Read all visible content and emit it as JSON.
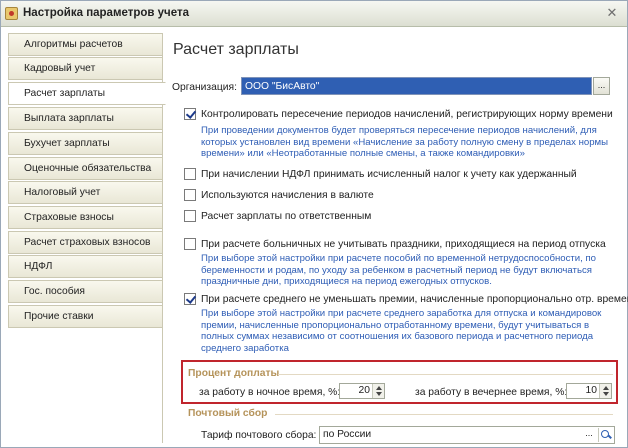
{
  "window": {
    "title": "Настройка параметров учета",
    "close_glyph": "✕"
  },
  "sidebar": {
    "items": [
      {
        "label": "Алгоритмы расчетов"
      },
      {
        "label": "Кадровый учет"
      },
      {
        "label": "Расчет зарплаты",
        "active": true
      },
      {
        "label": "Выплата зарплаты"
      },
      {
        "label": "Бухучет зарплаты"
      },
      {
        "label": "Оценочные обязательства"
      },
      {
        "label": "Налоговый учет"
      },
      {
        "label": "Страховые взносы"
      },
      {
        "label": "Расчет страховых взносов"
      },
      {
        "label": "НДФЛ"
      },
      {
        "label": "Гос. пособия"
      },
      {
        "label": "Прочие ставки"
      }
    ]
  },
  "main": {
    "title": "Расчет зарплаты",
    "organization": {
      "label": "Организация:",
      "value": "ООО \"БисАвто\"",
      "button": "..."
    },
    "options": [
      {
        "label": "Контролировать пересечение периодов начислений, регистрирующих норму времени",
        "checked": true,
        "hint": [
          "При проведении документов будет проверяться пересечение периодов начислений, для",
          "которых установлен вид времени «Начисление за работу полную смену в пределах нормы",
          "времени» или «Неотработанные полные смены, а также командировки»"
        ]
      },
      {
        "label": "При начислении НДФЛ принимать исчисленный налог к учету как удержанный",
        "checked": false
      },
      {
        "label": "Используются начисления в валюте",
        "checked": false
      },
      {
        "label": "Расчет зарплаты по ответственным",
        "checked": false
      },
      {
        "label": "При расчете больничных не учитывать праздники, приходящиеся на период отпуска",
        "checked": false,
        "hint": [
          "При выборе этой настройки при расчете пособий по временной нетрудоспособности, по",
          "беременности и родам, по уходу за ребенком в расчетный период не будут включаться",
          "праздничные дни, приходящиеся на период ежегодных отпусков."
        ]
      },
      {
        "label": "При расчете среднего не уменьшать премии, начисленные пропорционально отр. времени",
        "checked": true,
        "hint": [
          "При выборе этой настройки при расчете среднего заработка для отпуска и командировок",
          "премии, начисленные пропорционально отработанному времени, будут учитываться в",
          "полных суммах независимо от соотношения их базового периода и расчетного периода",
          "среднего заработка"
        ]
      }
    ],
    "surcharge": {
      "title": "Процент доплаты",
      "night_label": "за работу в ночное время, %:",
      "night_value": "20",
      "evening_label": "за работу в вечернее время, %:",
      "evening_value": "10"
    },
    "postal": {
      "title": "Почтовый сбор",
      "tariff_label": "Тариф почтового сбора:",
      "tariff_value": "по России",
      "select_button": "..."
    }
  }
}
